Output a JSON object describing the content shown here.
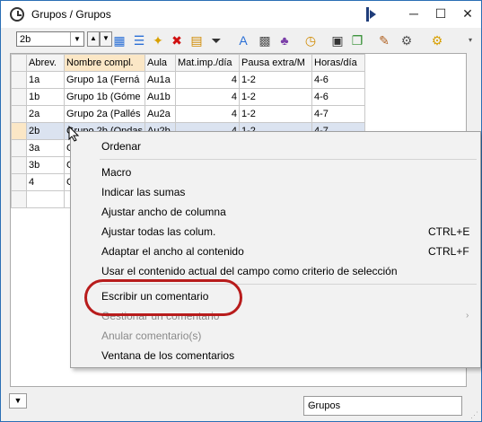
{
  "window": {
    "title": "Grupos / Grupos",
    "minimize": "─",
    "maximize": "☐",
    "close": "✕"
  },
  "toolbar": {
    "selector_value": "2b"
  },
  "grid": {
    "columns": [
      "Abrev.",
      "Nombre compl.",
      "Aula",
      "Mat.imp./día",
      "Pausa extra/M",
      "Horas/día"
    ],
    "rows": [
      [
        "1a",
        "Grupo 1a (Ferná",
        "Au1a",
        "4",
        "1-2",
        "4-6"
      ],
      [
        "1b",
        "Grupo 1b (Góme",
        "Au1b",
        "4",
        "1-2",
        "4-6"
      ],
      [
        "2a",
        "Grupo 2a (Pallés",
        "Au2a",
        "4",
        "1-2",
        "4-7"
      ],
      [
        "2b",
        "Grupo 2b (Ondas",
        "Au2b",
        "4",
        "1-2",
        "4-7"
      ],
      [
        "3a",
        "G",
        "",
        "",
        "",
        ""
      ],
      [
        "3b",
        "G",
        "",
        "",
        "",
        ""
      ],
      [
        "4",
        "G",
        "",
        "",
        "",
        ""
      ]
    ]
  },
  "context_menu": {
    "items": [
      {
        "label": "Ordenar",
        "shortcut": "",
        "disabled": false
      },
      {
        "label": "Macro",
        "shortcut": "",
        "disabled": false
      },
      {
        "label": "Indicar las sumas",
        "shortcut": "",
        "disabled": false
      },
      {
        "label": "Ajustar ancho de columna",
        "shortcut": "",
        "disabled": false
      },
      {
        "label": "Ajustar todas las colum.",
        "shortcut": "CTRL+E",
        "disabled": false
      },
      {
        "label": "Adaptar el ancho al contenido",
        "shortcut": "CTRL+F",
        "disabled": false
      },
      {
        "label": "Usar el contenido actual del campo como criterio de selección",
        "shortcut": "",
        "disabled": false
      },
      {
        "label": "Escribir un comentario",
        "shortcut": "",
        "disabled": false
      },
      {
        "label": "Gestionar un comentario",
        "shortcut": "",
        "disabled": true
      },
      {
        "label": "Anular comentario(s)",
        "shortcut": "",
        "disabled": true
      },
      {
        "label": "Ventana de los comentarios",
        "shortcut": "",
        "disabled": false
      }
    ]
  },
  "footer": {
    "view_select": "Grupos"
  },
  "colors": {
    "highlight_ring": "#b81c1c",
    "selected_header": "#fbe7c6",
    "title_border": "#2b6fb5"
  }
}
